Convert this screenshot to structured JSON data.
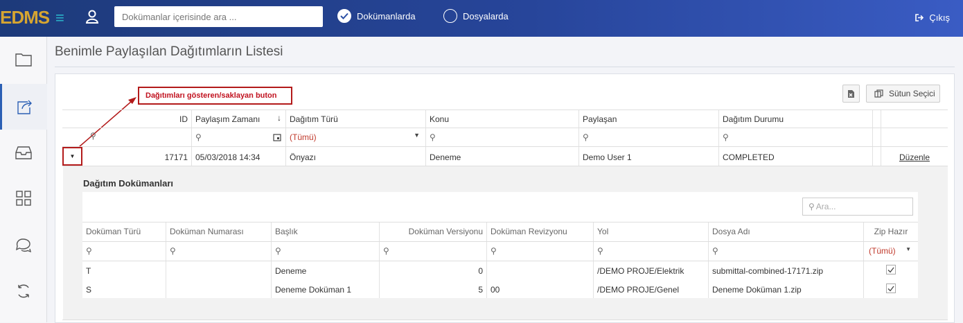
{
  "app": {
    "logo": "EDMS"
  },
  "header": {
    "search_placeholder": "Dokümanlar içerisinde ara ...",
    "radio_documents": "Dokümanlarda",
    "radio_folders": "Dosyalarda",
    "logout_label": "Çıkış"
  },
  "sidebar": {
    "items": [
      "folder-icon",
      "share-icon",
      "inbox-icon",
      "grid-icon",
      "chat-icon",
      "sync-icon"
    ]
  },
  "page": {
    "title": "Benimle Paylaşılan Dağıtımların Listesi"
  },
  "annotation": {
    "text": "Dağıtımları gösteren/saklayan buton"
  },
  "toolbar": {
    "column_chooser": "Sütun Seçici"
  },
  "grid": {
    "columns": [
      "ID",
      "Paylaşım Zamanı",
      "Dağıtım Türü",
      "Konu",
      "Paylaşan",
      "Dağıtım Durumu"
    ],
    "filter_all": "(Tümü)",
    "rows": [
      {
        "id": "17171",
        "time": "05/03/2018 14:34",
        "type": "Önyazı",
        "subject": "Deneme",
        "sharer": "Demo User 1",
        "status": "COMPLETED",
        "action": "Düzenle"
      }
    ]
  },
  "detail": {
    "title": "Dağıtım Dokümanları",
    "search_placeholder": "Ara...",
    "columns": [
      "Doküman Türü",
      "Doküman Numarası",
      "Başlık",
      "Doküman Versiyonu",
      "Doküman Revizyonu",
      "Yol",
      "Dosya Adı",
      "Zip Hazır"
    ],
    "filter_all": "(Tümü)",
    "rows": [
      {
        "type": "T",
        "number": "",
        "title": "Deneme",
        "version": "0",
        "revision": "",
        "path": "/DEMO PROJE/Elektrik",
        "file": "submittal-combined-17171.zip",
        "zip": true
      },
      {
        "type": "S",
        "number": "",
        "title": "Deneme Doküman 1",
        "version": "5",
        "revision": "00",
        "path": "/DEMO PROJE/Genel",
        "file": "Deneme Doküman 1.zip",
        "zip": true
      }
    ]
  }
}
